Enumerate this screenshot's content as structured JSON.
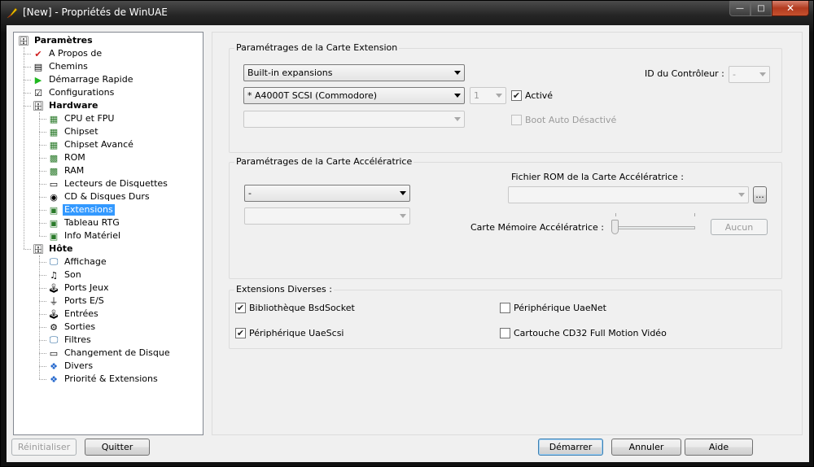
{
  "window": {
    "title": "[New] - Propriétés de WinUAE",
    "min_label": "—",
    "max_label": "□",
    "close_label": "✕"
  },
  "tree": [
    {
      "label": "Paramètres",
      "icon": "disk-stack-icon",
      "glyph": "🗄",
      "bold": true
    },
    {
      "label": "A Propos de",
      "icon": "checkmark-pencil-icon",
      "glyph": "✔"
    },
    {
      "label": "Chemins",
      "icon": "document-list-icon",
      "glyph": "▤"
    },
    {
      "label": "Démarrage Rapide",
      "icon": "play-arrow-icon",
      "glyph": "▶"
    },
    {
      "label": "Configurations",
      "icon": "checklist-icon",
      "glyph": "☑"
    },
    {
      "label": "Hardware",
      "icon": "disk-stack-icon",
      "glyph": "🗄",
      "bold": true
    },
    {
      "label": "CPU et FPU",
      "icon": "chip-icon",
      "glyph": "▦"
    },
    {
      "label": "Chipset",
      "icon": "chip-icon",
      "glyph": "▦"
    },
    {
      "label": "Chipset Avancé",
      "icon": "chip-icon",
      "glyph": "▦"
    },
    {
      "label": "ROM",
      "icon": "memory-chip-icon",
      "glyph": "▩"
    },
    {
      "label": "RAM",
      "icon": "memory-chip-icon",
      "glyph": "▩"
    },
    {
      "label": "Lecteurs de Disquettes",
      "icon": "floppy-drive-icon",
      "glyph": "▭"
    },
    {
      "label": "CD & Disques Durs",
      "icon": "hard-disk-icon",
      "glyph": "◉"
    },
    {
      "label": "Extensions",
      "icon": "expansion-card-icon",
      "glyph": "▣",
      "selected": true
    },
    {
      "label": "Tableau RTG",
      "icon": "expansion-card-icon",
      "glyph": "▣"
    },
    {
      "label": "Info Matériel",
      "icon": "expansion-card-icon",
      "glyph": "▣"
    },
    {
      "label": "Hôte",
      "icon": "disk-stack-icon",
      "glyph": "🗄",
      "bold": true
    },
    {
      "label": "Affichage",
      "icon": "monitor-icon",
      "glyph": "🖵"
    },
    {
      "label": "Son",
      "icon": "speaker-icon",
      "glyph": "♫"
    },
    {
      "label": "Ports Jeux",
      "icon": "joystick-icon",
      "glyph": "🕹"
    },
    {
      "label": "Ports E/S",
      "icon": "plug-icon",
      "glyph": "⏚"
    },
    {
      "label": "Entrées",
      "icon": "joystick-icon",
      "glyph": "🕹"
    },
    {
      "label": "Sorties",
      "icon": "gear-arrows-icon",
      "glyph": "⚙"
    },
    {
      "label": "Filtres",
      "icon": "monitor-icon",
      "glyph": "🖵"
    },
    {
      "label": "Changement de Disque",
      "icon": "floppy-drive-icon",
      "glyph": "▭"
    },
    {
      "label": "Divers",
      "icon": "colored-shapes-icon",
      "glyph": "❖"
    },
    {
      "label": "Priorité & Extensions",
      "icon": "colored-shapes-icon",
      "glyph": "❖"
    }
  ],
  "expansion": {
    "title": "Paramétrages de la Carte Extension",
    "category_value": "Built-in expansions",
    "board_value": "* A4000T SCSI (Commodore)",
    "unit_value": "1",
    "controller_label": "ID du Contrôleur :",
    "controller_value": "-",
    "enabled_label": "Activé",
    "enabled_checked": true,
    "autoboot_label": "Boot Auto Désactivé",
    "autoboot_checked": false
  },
  "accelerator": {
    "title": "Paramétrages de la Carte Accélératrice",
    "board_value": "-",
    "rom_label": "Fichier ROM de la Carte Accélératrice :",
    "browse_label": "...",
    "memory_label": "Carte Mémoire Accélératrice :",
    "memory_slider_level": 0,
    "none_button": "Aucun"
  },
  "misc": {
    "title": "Extensions Diverses :",
    "items": [
      {
        "label": "Bibliothèque BsdSocket",
        "checked": true
      },
      {
        "label": "Périphérique UaeNet",
        "checked": false
      },
      {
        "label": "Périphérique UaeScsi",
        "checked": true
      },
      {
        "label": "Cartouche CD32 Full Motion Vidéo",
        "checked": false
      }
    ]
  },
  "footer": {
    "reset": "Réinitialiser",
    "quit": "Quitter",
    "start": "Démarrer",
    "cancel": "Annuler",
    "help": "Aide"
  },
  "colors": {
    "selection": "#3399ff",
    "close_button": "#c6512e",
    "window_frame": "#1a1a1a"
  }
}
